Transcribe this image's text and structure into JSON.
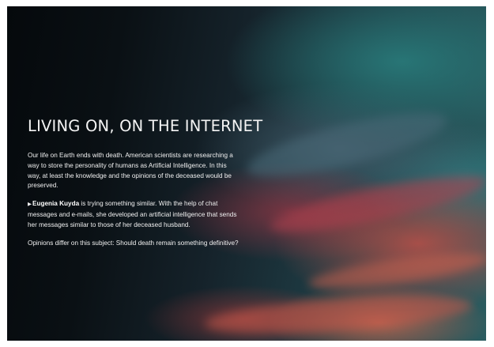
{
  "article": {
    "title": "LIVING ON, ON THE INTERNET",
    "paragraph1": "Our life on Earth ends with death. American scientists are researching a way to store the personality of humans as Artificial Intelligence. In this way, at least the knowledge and the opinions of the deceased would be preserved.",
    "paragraph2_marker": "▶",
    "paragraph2_name": "Eugenia Kuyda",
    "paragraph2_rest": " is trying something similar. With the help of chat messages and e-mails, she developed an artificial intelligence that sends her messages similar to those of her deceased husband.",
    "paragraph3": "Opinions differ on this subject: Should death remain something definitive?"
  },
  "colors": {
    "text": "#ffffff",
    "sky_dark": "#05090c",
    "sky_teal": "#2a5c60",
    "sunset_red": "#d25046"
  }
}
